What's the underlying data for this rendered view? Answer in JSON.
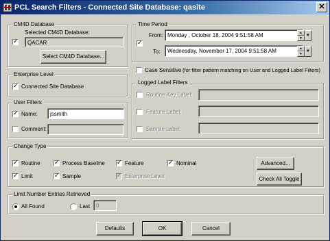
{
  "window": {
    "title": "PCL Search Filters  - Connected Site Database: qasite"
  },
  "cm4d": {
    "legend": "CM4D Database",
    "selected_label": "Selected CM4D Database:",
    "selected_value": "QACAR",
    "select_button": "Select CM4D Database...",
    "checked": true
  },
  "enterprise": {
    "legend": "Enterprise Level",
    "connected_label": "Connected Site Database",
    "checked": true
  },
  "user_filters": {
    "legend": "User Filters",
    "name_label": "Name:",
    "name_value": "jssmith",
    "name_checked": true,
    "comment_label": "Comment:",
    "comment_value": "",
    "comment_checked": false
  },
  "time_period": {
    "legend": "Time Period",
    "from_label": "From:",
    "from_value": "Monday   ,  October  18, 2004  9:51:58 AM",
    "to_label": "To:",
    "to_value": "Wednesday, November 17, 2004  9:51:58 AM",
    "checked": true
  },
  "case_sensitive": {
    "label": "Case Sensitive",
    "note": "(for filter pattern matching on User and Logged Label Filters)",
    "checked": false
  },
  "logged_label": {
    "legend": "Logged Label Filters",
    "routine_key_label": "Routine Key Label:",
    "feature_label": "Feature Label:",
    "sample_label": "Sample Label:"
  },
  "change_type": {
    "legend": "Change Type",
    "routine": "Routine",
    "process_baseline": "Process Baseline",
    "feature": "Feature",
    "nominal": "Nominal",
    "limit": "Limit",
    "sample": "Sample",
    "enterprise_level": "Enterprise Level",
    "advanced_button": "Advanced...",
    "check_all_button": "Check All Toggle"
  },
  "limit_entries": {
    "legend": "Limit Number Entries Retrieved",
    "all_found": "All Found",
    "last": "Last",
    "last_value": "0"
  },
  "footer": {
    "defaults": "Defaults",
    "ok": "OK",
    "cancel": "Cancel"
  }
}
